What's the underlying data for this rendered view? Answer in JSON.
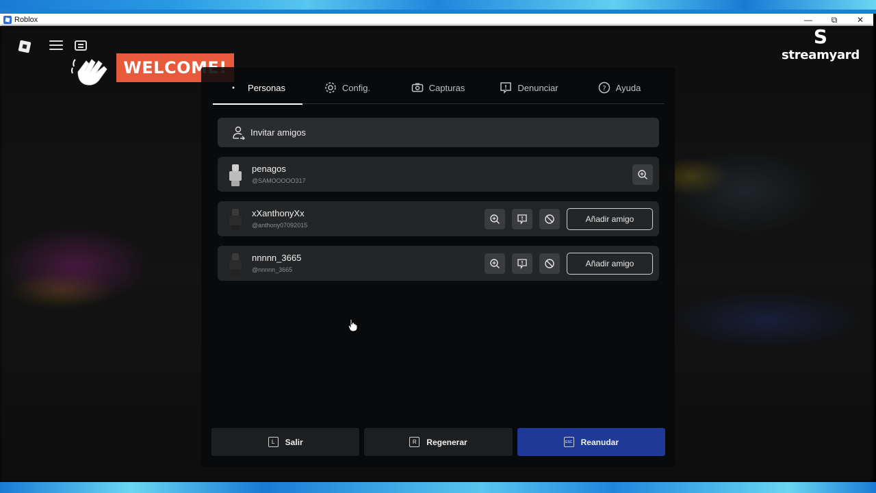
{
  "window": {
    "title": "Roblox",
    "controls": {
      "minimize": "—",
      "restore": "⧉",
      "close": "✕"
    }
  },
  "overlay": {
    "welcome": "WELCOME!",
    "streamyard_mark": "S",
    "streamyard_text": "streamyard"
  },
  "tabs": [
    {
      "label": "Personas",
      "icon": "people-icon",
      "active": true
    },
    {
      "label": "Config.",
      "icon": "gear-icon",
      "active": false
    },
    {
      "label": "Capturas",
      "icon": "camera-icon",
      "active": false
    },
    {
      "label": "Denunciar",
      "icon": "report-icon",
      "active": false
    },
    {
      "label": "Ayuda",
      "icon": "help-icon",
      "active": false
    }
  ],
  "invite": {
    "label": "Invitar amigos",
    "icon": "invite-friends-icon"
  },
  "players": [
    {
      "name": "penagos",
      "handle": "@SAMOOOOO317",
      "add_label": ""
    },
    {
      "name": "xXanthonyXx",
      "handle": "@anthony07092015",
      "add_label": "Añadir amigo"
    },
    {
      "name": "nnnnn_3665",
      "handle": "@nnnnn_3665",
      "add_label": "Añadir amigo"
    }
  ],
  "bottom": {
    "leave": {
      "key": "L",
      "label": "Salir"
    },
    "respawn": {
      "key": "R",
      "label": "Regenerar"
    },
    "resume": {
      "key": "ESC",
      "label": "Reanudar"
    }
  },
  "colors": {
    "welcome_bg": "#e85a3c",
    "resume_bg": "#1e3a96",
    "frame_blue": "#1b7fd6"
  }
}
